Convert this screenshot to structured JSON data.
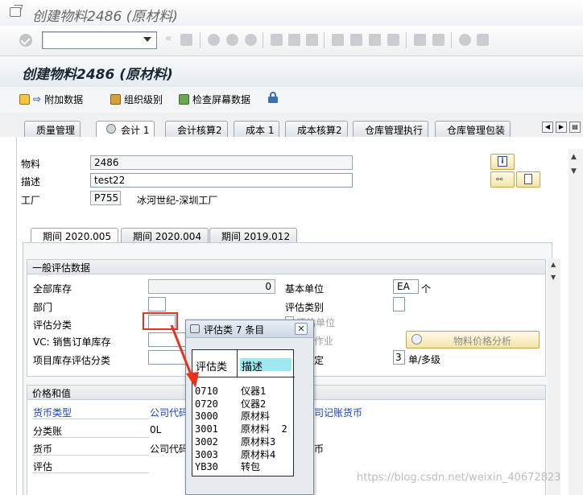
{
  "window": {
    "title": "创建物料2486 (原材料)"
  },
  "app": {
    "title": "创建物料2486 (原材料)",
    "toolbar": {
      "additional_data": "附加数据",
      "org_levels": "组织级别",
      "check_screen": "检查屏幕数据"
    }
  },
  "tabs": [
    "质量管理",
    "会计 1",
    "会计核算2",
    "成本 1",
    "成本核算2",
    "仓库管理执行",
    "仓库管理包装"
  ],
  "header": {
    "material_label": "物料",
    "material_value": "2486",
    "desc_label": "描述",
    "desc_value": "test22",
    "plant_label": "工厂",
    "plant_value": "P755",
    "plant_name": "冰河世纪-深圳工厂"
  },
  "subtabs": [
    "期间 2020.005",
    "期间 2020.004",
    "期间 2019.012"
  ],
  "general": {
    "title": "一般评估数据",
    "total_stock_label": "全部库存",
    "total_stock_value": "0",
    "base_unit_label": "基本单位",
    "base_unit_value": "EA",
    "base_unit_desc": "个",
    "division_label": "部门",
    "valuation_category_label": "评估类别",
    "valuation_class_label": "评估分类",
    "valuation_unit_partial": "评估单位",
    "vc_label": "VC: 销售订单库存",
    "project_label": "项目库存评估分类",
    "job_partial": "作业",
    "price_analysis_btn": "物料价格分析",
    "price_determination_partial": "定",
    "price_det_value": "3",
    "price_det_desc": "单/多级"
  },
  "price": {
    "title": "价格和值",
    "currency_type": "货币类型",
    "company_code_partial": "公司代码",
    "ledger_currency_partial": "司记账货币",
    "ledger_label": "分类账",
    "ledger_value": "0L",
    "currency_label": "货币",
    "company_code_partial2": "公司代码",
    "currency_partial": "币",
    "valuation_label": "评估"
  },
  "popup": {
    "title": "评估类 7 条目",
    "col_class": "评估类",
    "col_desc": "描述",
    "rows": [
      {
        "code": "0710",
        "desc": "仪器1"
      },
      {
        "code": "0720",
        "desc": "仪器2"
      },
      {
        "code": "3000",
        "desc": "原材料"
      },
      {
        "code": "3001",
        "desc": "原材料  2"
      },
      {
        "code": "3002",
        "desc": "原材料3"
      },
      {
        "code": "3003",
        "desc": "原材料4"
      },
      {
        "code": "YB30",
        "desc": "转包"
      }
    ]
  },
  "watermark": "https://blog.csdn.net/weixin_40672823",
  "colors": {
    "accent_yellow": "#f3e4a8",
    "highlight": "#9ee8f2",
    "annotation_red": "#e8321e"
  }
}
